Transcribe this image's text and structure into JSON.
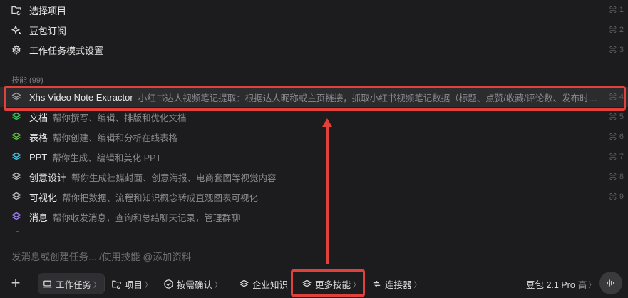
{
  "top_menu": [
    {
      "label": "选择项目",
      "shortcut": "1",
      "icon": "folder-sync-icon"
    },
    {
      "label": "豆包订阅",
      "shortcut": "2",
      "icon": "sparkle-icon"
    },
    {
      "label": "工作任务模式设置",
      "shortcut": "3",
      "icon": "gear-icon"
    }
  ],
  "shortcut_modifier": "⌘",
  "skills": {
    "section_label": "技能 (99)",
    "items": [
      {
        "title": "Xhs Video Note Extractor",
        "desc": "小红书达人视频笔记提取：根据达人昵称或主页链接，抓取小红书视频笔记数据（标题、点赞/收藏/评论数、发布时间...",
        "shortcut": "4",
        "icon": "layers-gray-icon",
        "color": "#9a9a9e"
      },
      {
        "title": "文档",
        "desc": "帮你撰写、编辑、排版和优化文档",
        "shortcut": "5",
        "icon": "layers-green-icon",
        "color": "#34c759"
      },
      {
        "title": "表格",
        "desc": "帮你创建、编辑和分析在线表格",
        "shortcut": "6",
        "icon": "layers-green-icon",
        "color": "#5fbf3a"
      },
      {
        "title": "PPT",
        "desc": "帮你生成、编辑和美化 PPT",
        "shortcut": "7",
        "icon": "layers-cyan-icon",
        "color": "#3ec6e0"
      },
      {
        "title": "创意设计",
        "desc": "帮你生成社媒封面、创意海报、电商套图等视觉内容",
        "shortcut": "8",
        "icon": "layers-gray-icon",
        "color": "#b8b8bc"
      },
      {
        "title": "可视化",
        "desc": "帮你把数据、流程和知识概念转成直观图表可视化",
        "shortcut": "9",
        "icon": "layers-gray-icon",
        "color": "#b8b8bc"
      },
      {
        "title": "消息",
        "desc": "帮你收发消息，查询和总结聊天记录，管理群聊",
        "shortcut": "",
        "icon": "layers-purple-icon",
        "color": "#9b7bf0"
      }
    ]
  },
  "input": {
    "placeholder": "发消息或创建任务... /使用技能 @添加资料"
  },
  "toolbar": {
    "add": "+",
    "work_task": "工作任务",
    "project": "项目",
    "confirm": "按需确认",
    "enterprise": "企业知识",
    "more_skills": "更多技能",
    "connector": "连接器",
    "chev": "〉"
  },
  "model": {
    "name": "豆包 2.1 Pro",
    "level": "高",
    "chev": "〉"
  },
  "colors": {
    "accent_red": "#e1413a",
    "background": "#1c1c1e"
  }
}
